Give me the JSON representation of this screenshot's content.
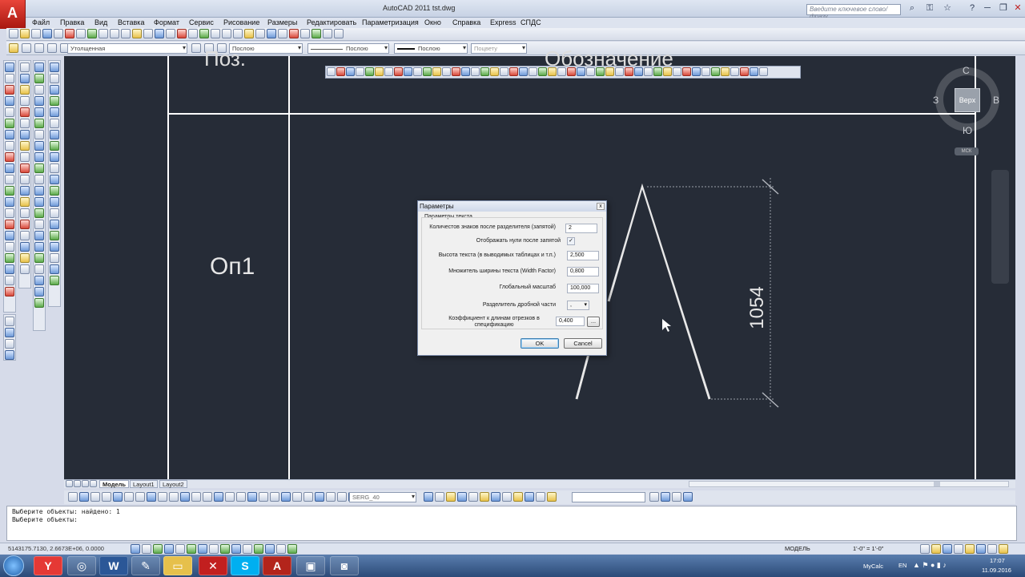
{
  "window": {
    "title": "AutoCAD 2011    tst.dwg",
    "logo": "A",
    "search_placeholder": "Введите ключевое слово/фразу"
  },
  "menu": [
    "Файл",
    "Правка",
    "Вид",
    "Вставка",
    "Формат",
    "Сервис",
    "Рисование",
    "Размеры",
    "Редактировать",
    "Параметризация",
    "Окно",
    "Справка",
    "Express",
    "СПДС"
  ],
  "toolbar2": {
    "visual_style": "Утолщенная",
    "layer": "Послою",
    "linetype": "Послою",
    "lineweight": "Послою",
    "plotstyle": "Поцвету"
  },
  "drawing": {
    "top_left_text": "Поз.",
    "top_right_text": "Обозначение",
    "left_label": "Оп1",
    "dimension": "1054"
  },
  "viewcube": {
    "north": "С",
    "south": "Ю",
    "west": "З",
    "east": "В",
    "face": "Верх",
    "wcs": "МСК"
  },
  "dialog": {
    "title": "Параметры",
    "group": "Параметры текста",
    "close_label": "x",
    "rows": [
      {
        "label": "Количестов знаков после разделителя (запятой)",
        "value": "2"
      },
      {
        "label": "Отображать нули после запятой",
        "value": "✓"
      },
      {
        "label": "Высота текста (в выводимых таблицах и т.п.)",
        "value": "2,500"
      },
      {
        "label": "Множитель ширины текста (Width Factor)",
        "value": "0,800"
      },
      {
        "label": "Глобальный масштаб",
        "value": "100,000"
      },
      {
        "label": "Разделитель дробной части",
        "value": ","
      },
      {
        "label": "Коэффициент к длинам отрезков в спецификацию",
        "value": "0,400"
      }
    ],
    "browse_label": "...",
    "ok_label": "OK",
    "cancel_label": "Cancel"
  },
  "layout_tabs": [
    "Модель",
    "Layout1",
    "Layout2"
  ],
  "bottom_toolbar": {
    "dimstyle": "SERG_40"
  },
  "command": {
    "line1": "Выберите объекты: найдено: 1",
    "line2": "Выберите объекты:"
  },
  "status": {
    "coords": "5143175.7130, 2.6673E+06, 0.0000",
    "model": "МОДЕЛЬ",
    "scale1": "1'-0\" = 1'-0\"",
    "mycalc": "MyCalc",
    "lang": "EN",
    "time": "17:07",
    "date": "11.09.2016"
  }
}
